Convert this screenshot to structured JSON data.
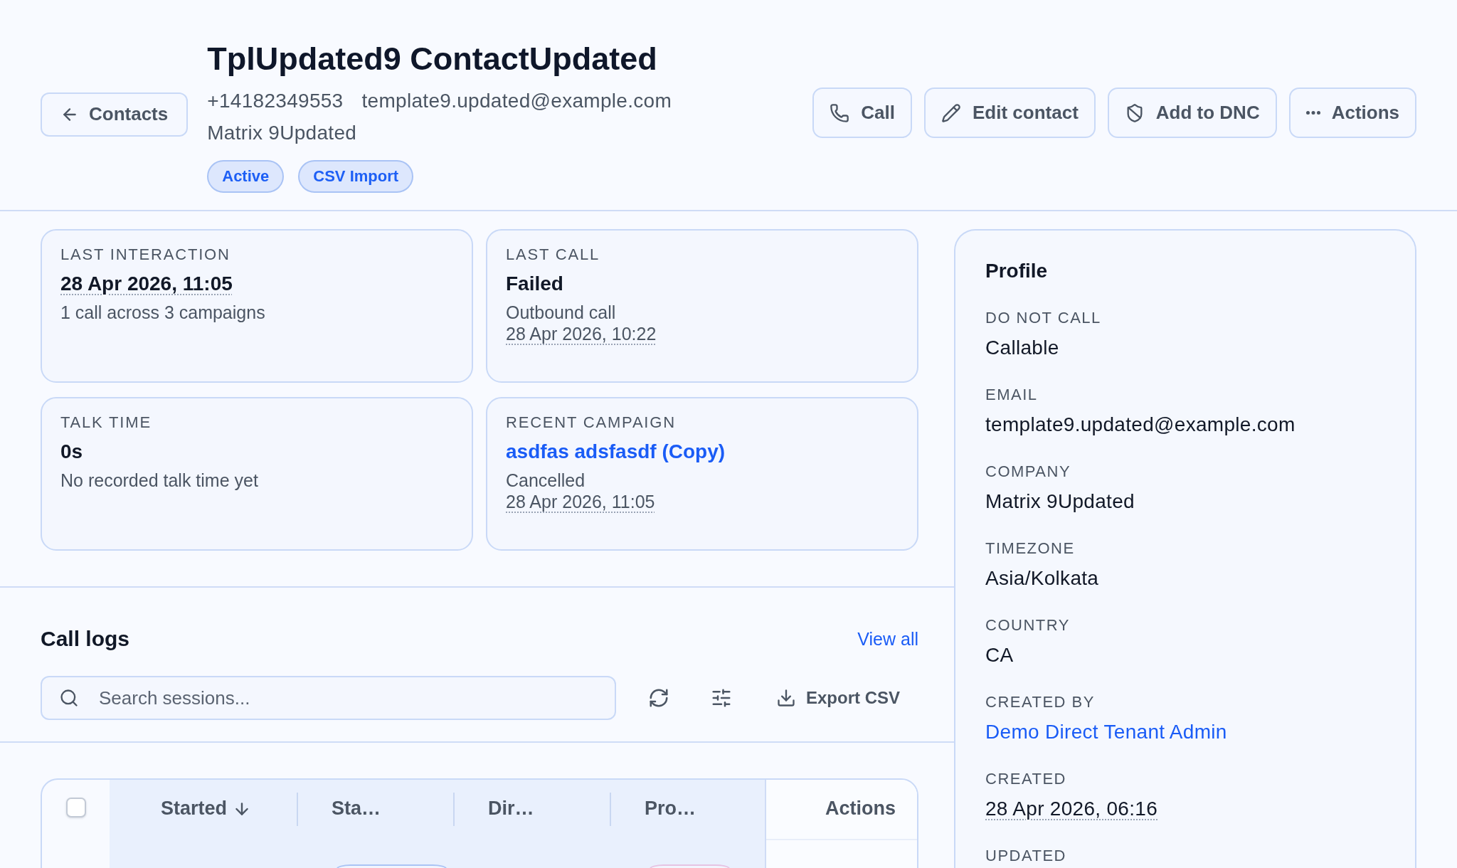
{
  "header": {
    "back_button": "Contacts",
    "title": "TplUpdated9 ContactUpdated",
    "phone": "+14182349553",
    "email": "template9.updated@example.com",
    "company": "Matrix 9Updated",
    "badges": [
      "Active",
      "CSV Import"
    ],
    "actions": [
      {
        "label": "Call",
        "kind": "call"
      },
      {
        "label": "Edit contact",
        "kind": "edit"
      },
      {
        "label": "Add to DNC",
        "kind": "dnc"
      },
      {
        "label": "Actions",
        "kind": "more"
      }
    ]
  },
  "summary_cards": [
    {
      "label": "LAST INTERACTION",
      "value": {
        "text": "28 Apr 2026, 11:05",
        "kind": "time"
      },
      "lines": [
        {
          "text": "1 call across 3 campaigns",
          "kind": "text"
        }
      ]
    },
    {
      "label": "LAST CALL",
      "value": {
        "text": "Failed",
        "kind": "text"
      },
      "lines": [
        {
          "text": "Outbound call",
          "kind": "text"
        },
        {
          "text": "28 Apr 2026, 10:22",
          "kind": "time"
        }
      ]
    },
    {
      "label": "TALK TIME",
      "value": {
        "text": "0s",
        "kind": "text"
      },
      "lines": [
        {
          "text": "No recorded talk time yet",
          "kind": "text"
        }
      ]
    },
    {
      "label": "RECENT CAMPAIGN",
      "value": {
        "text": "asdfas adsfasdf (Copy)",
        "kind": "link"
      },
      "lines": [
        {
          "text": "Cancelled",
          "kind": "text"
        },
        {
          "text": "28 Apr 2026, 11:05",
          "kind": "time"
        }
      ]
    }
  ],
  "call_logs": {
    "title": "Call logs",
    "view_all": "View all",
    "search": {
      "placeholder": "Search sessions..."
    },
    "export_button": "Export CSV",
    "table": {
      "select_all": {
        "checked": false
      },
      "columns": [
        {
          "label": "Started",
          "kind": "data",
          "sorted": true
        },
        {
          "label": "Sta…",
          "kind": "data",
          "sorted": false
        },
        {
          "label": "Dir…",
          "kind": "data",
          "sorted": false
        },
        {
          "label": "Pro…",
          "kind": "data",
          "sorted": false
        },
        {
          "label": "Actions",
          "kind": "actions",
          "sorted": false
        }
      ],
      "rows": [
        {
          "cells": [
            {
              "kind": "empty"
            },
            {
              "kind": "pill",
              "color": "#a9c3f5"
            },
            {
              "kind": "empty"
            },
            {
              "kind": "pill",
              "color": "#e6c3e3"
            }
          ]
        }
      ]
    }
  },
  "profile": {
    "title": "Profile",
    "fields": [
      {
        "label": "DO NOT CALL",
        "value": "Callable",
        "kind": "text"
      },
      {
        "label": "EMAIL",
        "value": "template9.updated@example.com",
        "kind": "text"
      },
      {
        "label": "COMPANY",
        "value": "Matrix 9Updated",
        "kind": "text"
      },
      {
        "label": "TIMEZONE",
        "value": "Asia/Kolkata",
        "kind": "text"
      },
      {
        "label": "COUNTRY",
        "value": "CA",
        "kind": "text"
      },
      {
        "label": "CREATED BY",
        "value": "Demo Direct Tenant Admin",
        "kind": "link"
      },
      {
        "label": "CREATED",
        "value": "28 Apr 2026, 06:16",
        "kind": "time"
      },
      {
        "label": "UPDATED"
      }
    ]
  }
}
